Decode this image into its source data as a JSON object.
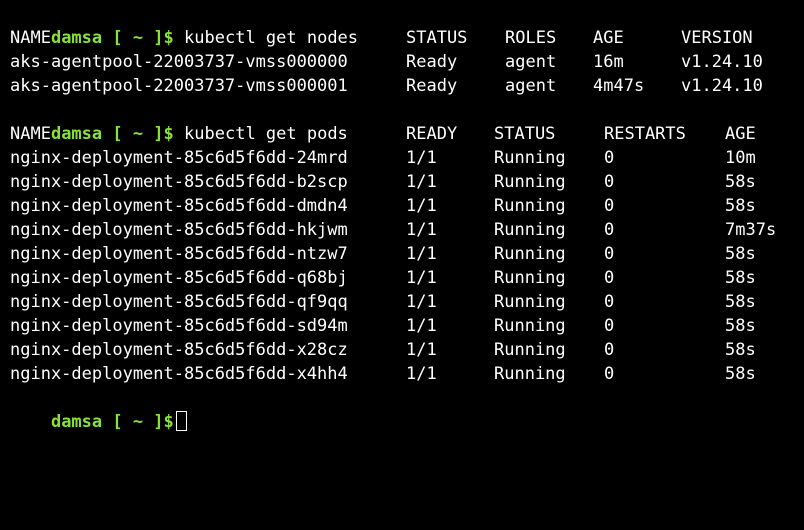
{
  "prompt": "damsa [ ~ ]$",
  "commands": {
    "get_nodes": "kubectl get nodes",
    "get_pods": "kubectl get pods"
  },
  "nodes": {
    "headers": [
      "NAME",
      "STATUS",
      "ROLES",
      "AGE",
      "VERSION"
    ],
    "rows": [
      [
        "aks-agentpool-22003737-vmss000000",
        "Ready",
        "agent",
        "16m",
        "v1.24.10"
      ],
      [
        "aks-agentpool-22003737-vmss000001",
        "Ready",
        "agent",
        "4m47s",
        "v1.24.10"
      ]
    ]
  },
  "pods": {
    "headers": [
      "NAME",
      "READY",
      "STATUS",
      "RESTARTS",
      "AGE"
    ],
    "rows": [
      [
        "nginx-deployment-85c6d5f6dd-24mrd",
        "1/1",
        "Running",
        "0",
        "10m"
      ],
      [
        "nginx-deployment-85c6d5f6dd-b2scp",
        "1/1",
        "Running",
        "0",
        "58s"
      ],
      [
        "nginx-deployment-85c6d5f6dd-dmdn4",
        "1/1",
        "Running",
        "0",
        "58s"
      ],
      [
        "nginx-deployment-85c6d5f6dd-hkjwm",
        "1/1",
        "Running",
        "0",
        "7m37s"
      ],
      [
        "nginx-deployment-85c6d5f6dd-ntzw7",
        "1/1",
        "Running",
        "0",
        "58s"
      ],
      [
        "nginx-deployment-85c6d5f6dd-q68bj",
        "1/1",
        "Running",
        "0",
        "58s"
      ],
      [
        "nginx-deployment-85c6d5f6dd-qf9qq",
        "1/1",
        "Running",
        "0",
        "58s"
      ],
      [
        "nginx-deployment-85c6d5f6dd-sd94m",
        "1/1",
        "Running",
        "0",
        "58s"
      ],
      [
        "nginx-deployment-85c6d5f6dd-x28cz",
        "1/1",
        "Running",
        "0",
        "58s"
      ],
      [
        "nginx-deployment-85c6d5f6dd-x4hh4",
        "1/1",
        "Running",
        "0",
        "58s"
      ]
    ]
  },
  "colors": {
    "background": "#000000",
    "prompt": "#8ae234",
    "text": "#ffffff"
  }
}
